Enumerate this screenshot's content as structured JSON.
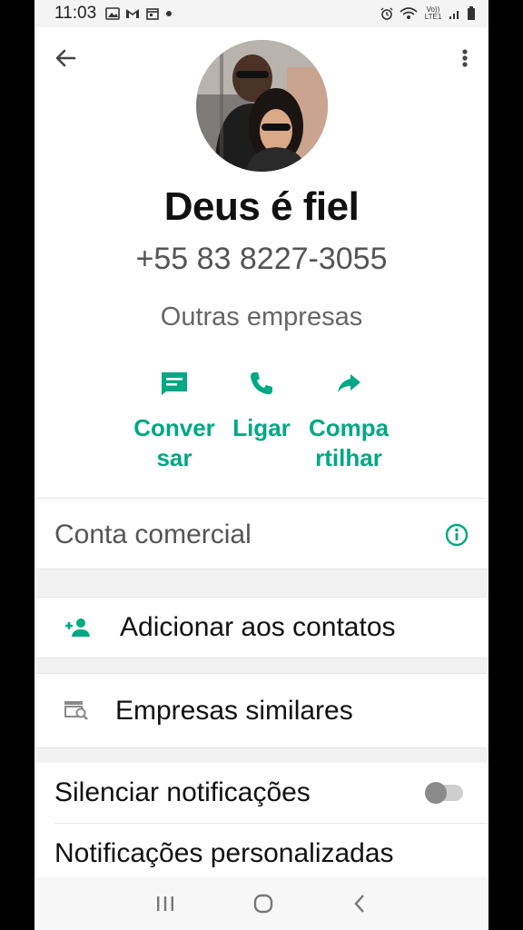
{
  "status_bar": {
    "time": "11:03",
    "left_icons": [
      "gallery-icon",
      "gmail-icon",
      "calendar-icon",
      "dot-icon"
    ],
    "right_icons": [
      "alarm-icon",
      "wifi-icon",
      "volte-lte-icon",
      "signal-icon",
      "battery-icon"
    ],
    "volte_label": "Vo)) LTE1"
  },
  "header": {
    "back_icon": "arrow-left-icon",
    "menu_icon": "more-vert-icon"
  },
  "profile": {
    "name": "Deus é fiel",
    "phone": "+55 83 8227-3055",
    "category": "Outras empresas"
  },
  "actions": [
    {
      "label": "Conver sar",
      "icon": "message-icon"
    },
    {
      "label": "Ligar",
      "icon": "phone-icon"
    },
    {
      "label": "Compa rtilhar",
      "icon": "share-icon"
    }
  ],
  "business_account": {
    "label": "Conta comercial",
    "icon": "info-icon"
  },
  "add_contact": {
    "label": "Adicionar aos contatos",
    "icon": "person-add-icon"
  },
  "similar": {
    "label": "Empresas similares",
    "icon": "store-search-icon"
  },
  "mute": {
    "label": "Silenciar notificações",
    "enabled": false
  },
  "custom_notifications": {
    "label": "Notificações personalizadas"
  },
  "nav": {
    "items": [
      "recents-icon",
      "home-icon",
      "back-icon"
    ]
  },
  "colors": {
    "accent": "#00a884",
    "text": "#111111",
    "muted": "#555555"
  }
}
